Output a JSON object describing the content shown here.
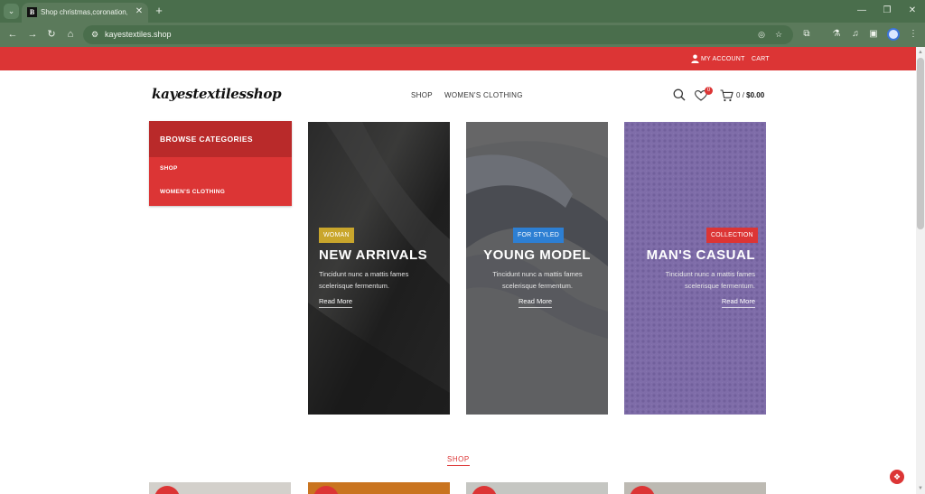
{
  "browser": {
    "tab_title": "Shop christmas,coronation,Hal",
    "tab_favicon_letter": "B",
    "url": "kayestextiles.shop",
    "icons": [
      "tab-list-icon",
      "close-icon",
      "plus-icon",
      "minimize-icon",
      "restore-icon",
      "close-window-icon",
      "back-icon",
      "forward-icon",
      "reload-icon",
      "home-icon",
      "site-info-icon",
      "eye-off-icon",
      "star-icon",
      "extensions-icon",
      "lab-icon",
      "media-icon",
      "sidebar-icon",
      "profile-icon",
      "menu-icon"
    ]
  },
  "topbar": {
    "account_label": "MY ACCOUNT",
    "cart_label": "CART",
    "color": "#dc3535"
  },
  "header": {
    "logo": "kayestextilesshop",
    "nav": [
      "SHOP",
      "WOMEN'S CLOTHING"
    ],
    "wishlist_count": "0",
    "cart_count": "0",
    "cart_separator": "/",
    "cart_amount": "$0.00"
  },
  "categories": {
    "title": "BROWSE CATEGORIES",
    "items": [
      "SHOP",
      "WOMEN'S CLOTHING"
    ]
  },
  "banners": [
    {
      "badge": "WOMAN",
      "badge_color": "#c9a62c",
      "title": "NEW ARRIVALS",
      "text": "Tincidunt nunc a mattis fames scelerisque fermentum.",
      "link": "Read More"
    },
    {
      "badge": "FOR STYLED",
      "badge_color": "#2d7fd3",
      "title": "YOUNG MODEL",
      "text": "Tincidunt nunc a mattis fames scelerisque fermentum.",
      "link": "Read More"
    },
    {
      "badge": "COLLECTION",
      "badge_color": "#dc3535",
      "title": "MAN'S CASUAL",
      "text": "Tincidunt nunc a mattis fames scelerisque fermentum.",
      "link": "Read More"
    }
  ],
  "shop_section": {
    "heading": "SHOP"
  }
}
